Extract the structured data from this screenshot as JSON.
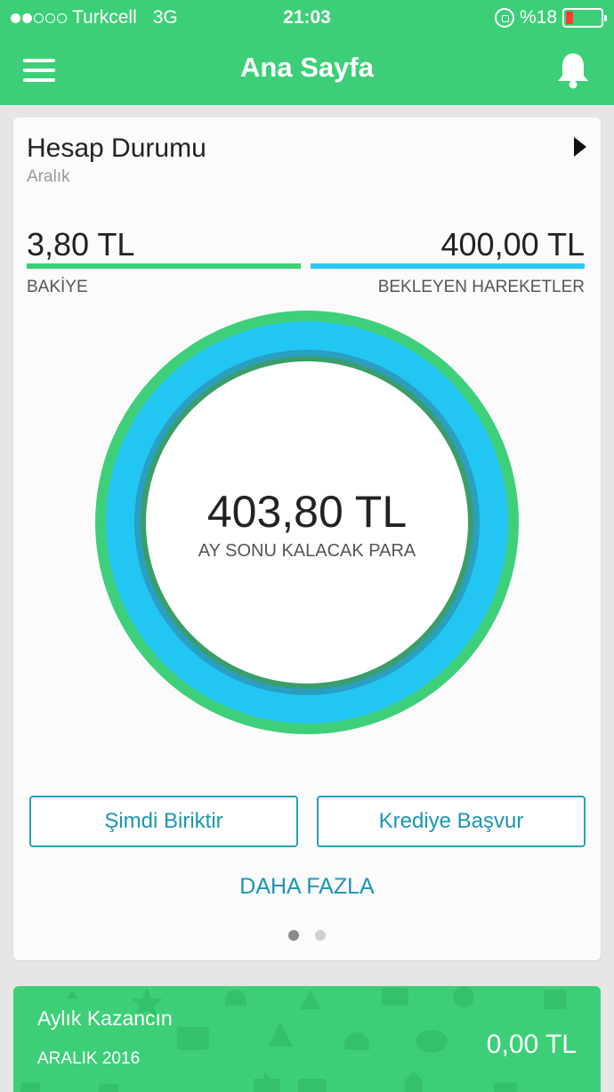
{
  "status_bar": {
    "carrier": "Turkcell",
    "network": "3G",
    "time": "21:03",
    "battery": "%18",
    "signal_strength": 2,
    "signal_max": 5,
    "battery_level": 0.18,
    "battery_color": "#ff3b30"
  },
  "header": {
    "title": "Ana Sayfa",
    "menu_icon": "hamburger-menu-icon",
    "bell_icon": "bell-icon",
    "color": "#3dcf78"
  },
  "account_card": {
    "title": "Hesap Durumu",
    "subtitle": "Aralık",
    "arrow_icon": "chevron-right-icon",
    "balance": {
      "amount": "3,80 TL",
      "label": "BAKİYE",
      "color": "#3dcf78"
    },
    "pending": {
      "amount": "400,00 TL",
      "label": "BEKLEYEN HAREKETLER",
      "color": "#2ec7f5"
    },
    "summary": {
      "amount": "403,80 TL",
      "label": "AY SONU KALACAK PARA"
    },
    "buttons": {
      "save": "Şimdi Biriktir",
      "loan": "Krediye Başvur"
    },
    "more_link": "DAHA FAZLA",
    "pager": {
      "pages": 2,
      "active": 0
    }
  },
  "earnings_card": {
    "title": "Aylık Kazancın",
    "period": "ARALIK 2016",
    "amount": "0,00 TL"
  }
}
